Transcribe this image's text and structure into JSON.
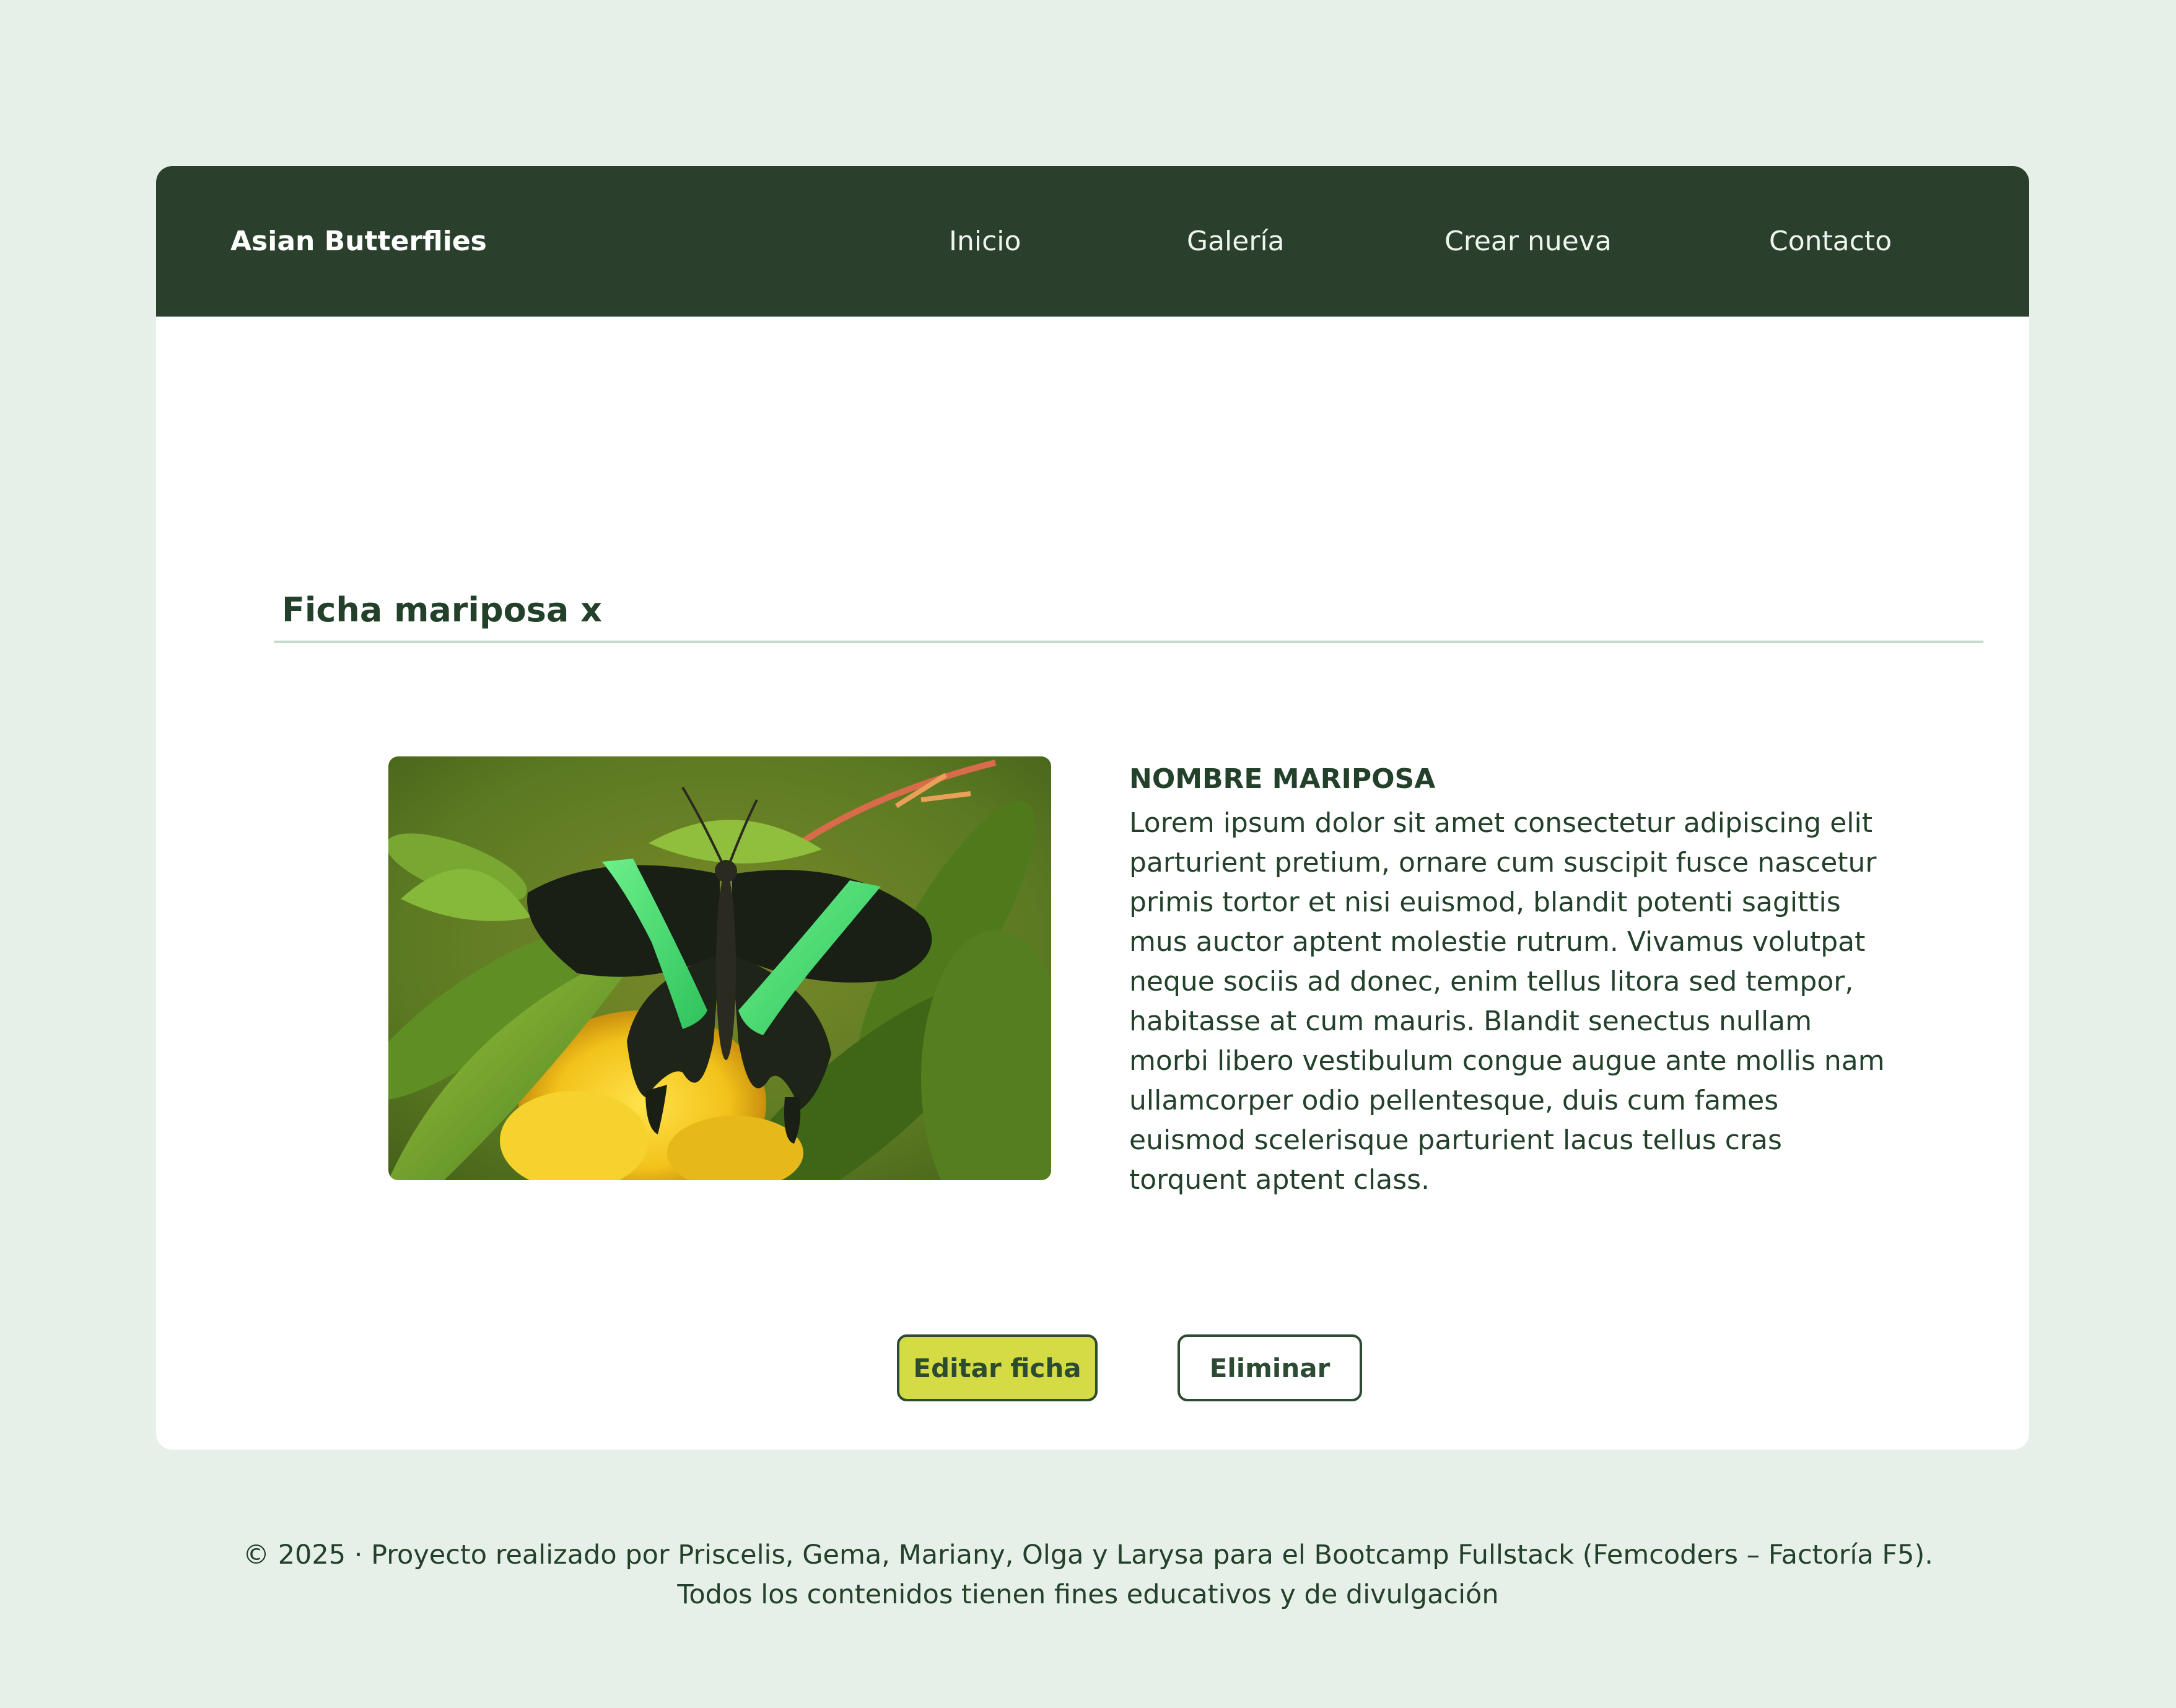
{
  "header": {
    "brand": "Asian Butterflies",
    "nav": [
      {
        "label": "Inicio"
      },
      {
        "label": "Galería"
      },
      {
        "label": "Crear nueva"
      },
      {
        "label": "Contacto"
      }
    ]
  },
  "main": {
    "title": "Ficha mariposa x",
    "butterfly": {
      "name": "NOMBRE MARIPOSA",
      "description": "Lorem ipsum dolor sit amet consectetur adipiscing elit parturient pretium, ornare cum suscipit fusce nascetur primis tortor et nisi euismod, blandit potenti sagittis mus auctor aptent molestie rutrum. Vivamus volutpat neque sociis ad donec, enim tellus litora sed tempor, habitasse at cum mauris. Blandit senectus nullam morbi libero vestibulum congue augue ante mollis nam ullamcorper odio pellentesque, duis cum fames euismod scelerisque parturient lacus tellus cras torquent aptent class."
    },
    "actions": {
      "edit_label": "Editar ficha",
      "delete_label": "Eliminar"
    }
  },
  "footer": {
    "line1": "© 2025 · Proyecto realizado por Priscelis, Gema, Mariany, Olga y Larysa para el Bootcamp Fullstack (Femcoders – Factoría F5).",
    "line2": "Todos los contenidos tienen fines educativos y de divulgación"
  },
  "colors": {
    "page_background": "#e6f0e8",
    "nav_background": "#2a402c",
    "primary_text": "#23402a",
    "edit_button": "#d4db44",
    "divider": "#c6ddcb"
  }
}
